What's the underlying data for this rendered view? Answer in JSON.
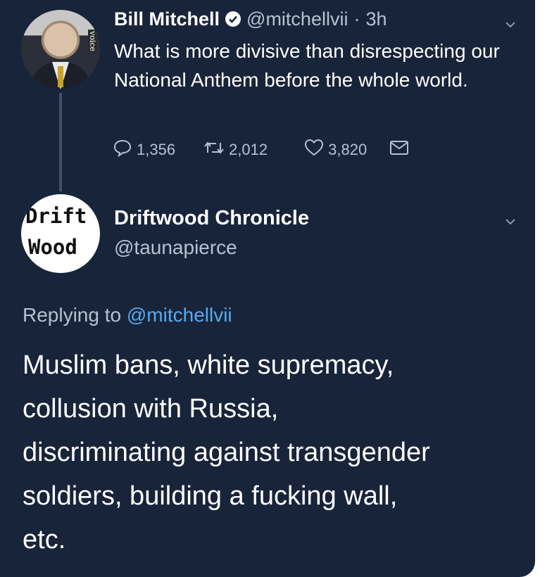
{
  "tweet1": {
    "author_name": "Bill Mitchell",
    "handle": "@mitchellvii",
    "separator": "·",
    "time": "3h",
    "avatar_sidetext": "voice",
    "text": "What is more divisive than disrespecting our National Anthem before the whole world.",
    "actions": {
      "replies": "1,356",
      "retweets": "2,012",
      "likes": "3,820"
    },
    "icons": [
      "verified-badge-icon",
      "chevron-down-icon",
      "reply-icon",
      "retweet-icon",
      "heart-icon",
      "mail-icon"
    ]
  },
  "tweet2": {
    "author_name": "Driftwood Chronicle",
    "handle": "@taunapierce",
    "avatar_logo": {
      "line1": "Drift",
      "line2": "Wood"
    },
    "replying_prefix": "Replying to",
    "replying_to": "@mitchellvii",
    "text_lines": [
      "Muslim bans, white supremacy,",
      "collusion with Russia,",
      "discriminating against transgender",
      "soldiers, building a fucking wall,",
      "etc."
    ]
  },
  "colors": {
    "background": "#18243a",
    "secondary_text": "#b6c2d2",
    "link": "#57a9ef"
  }
}
